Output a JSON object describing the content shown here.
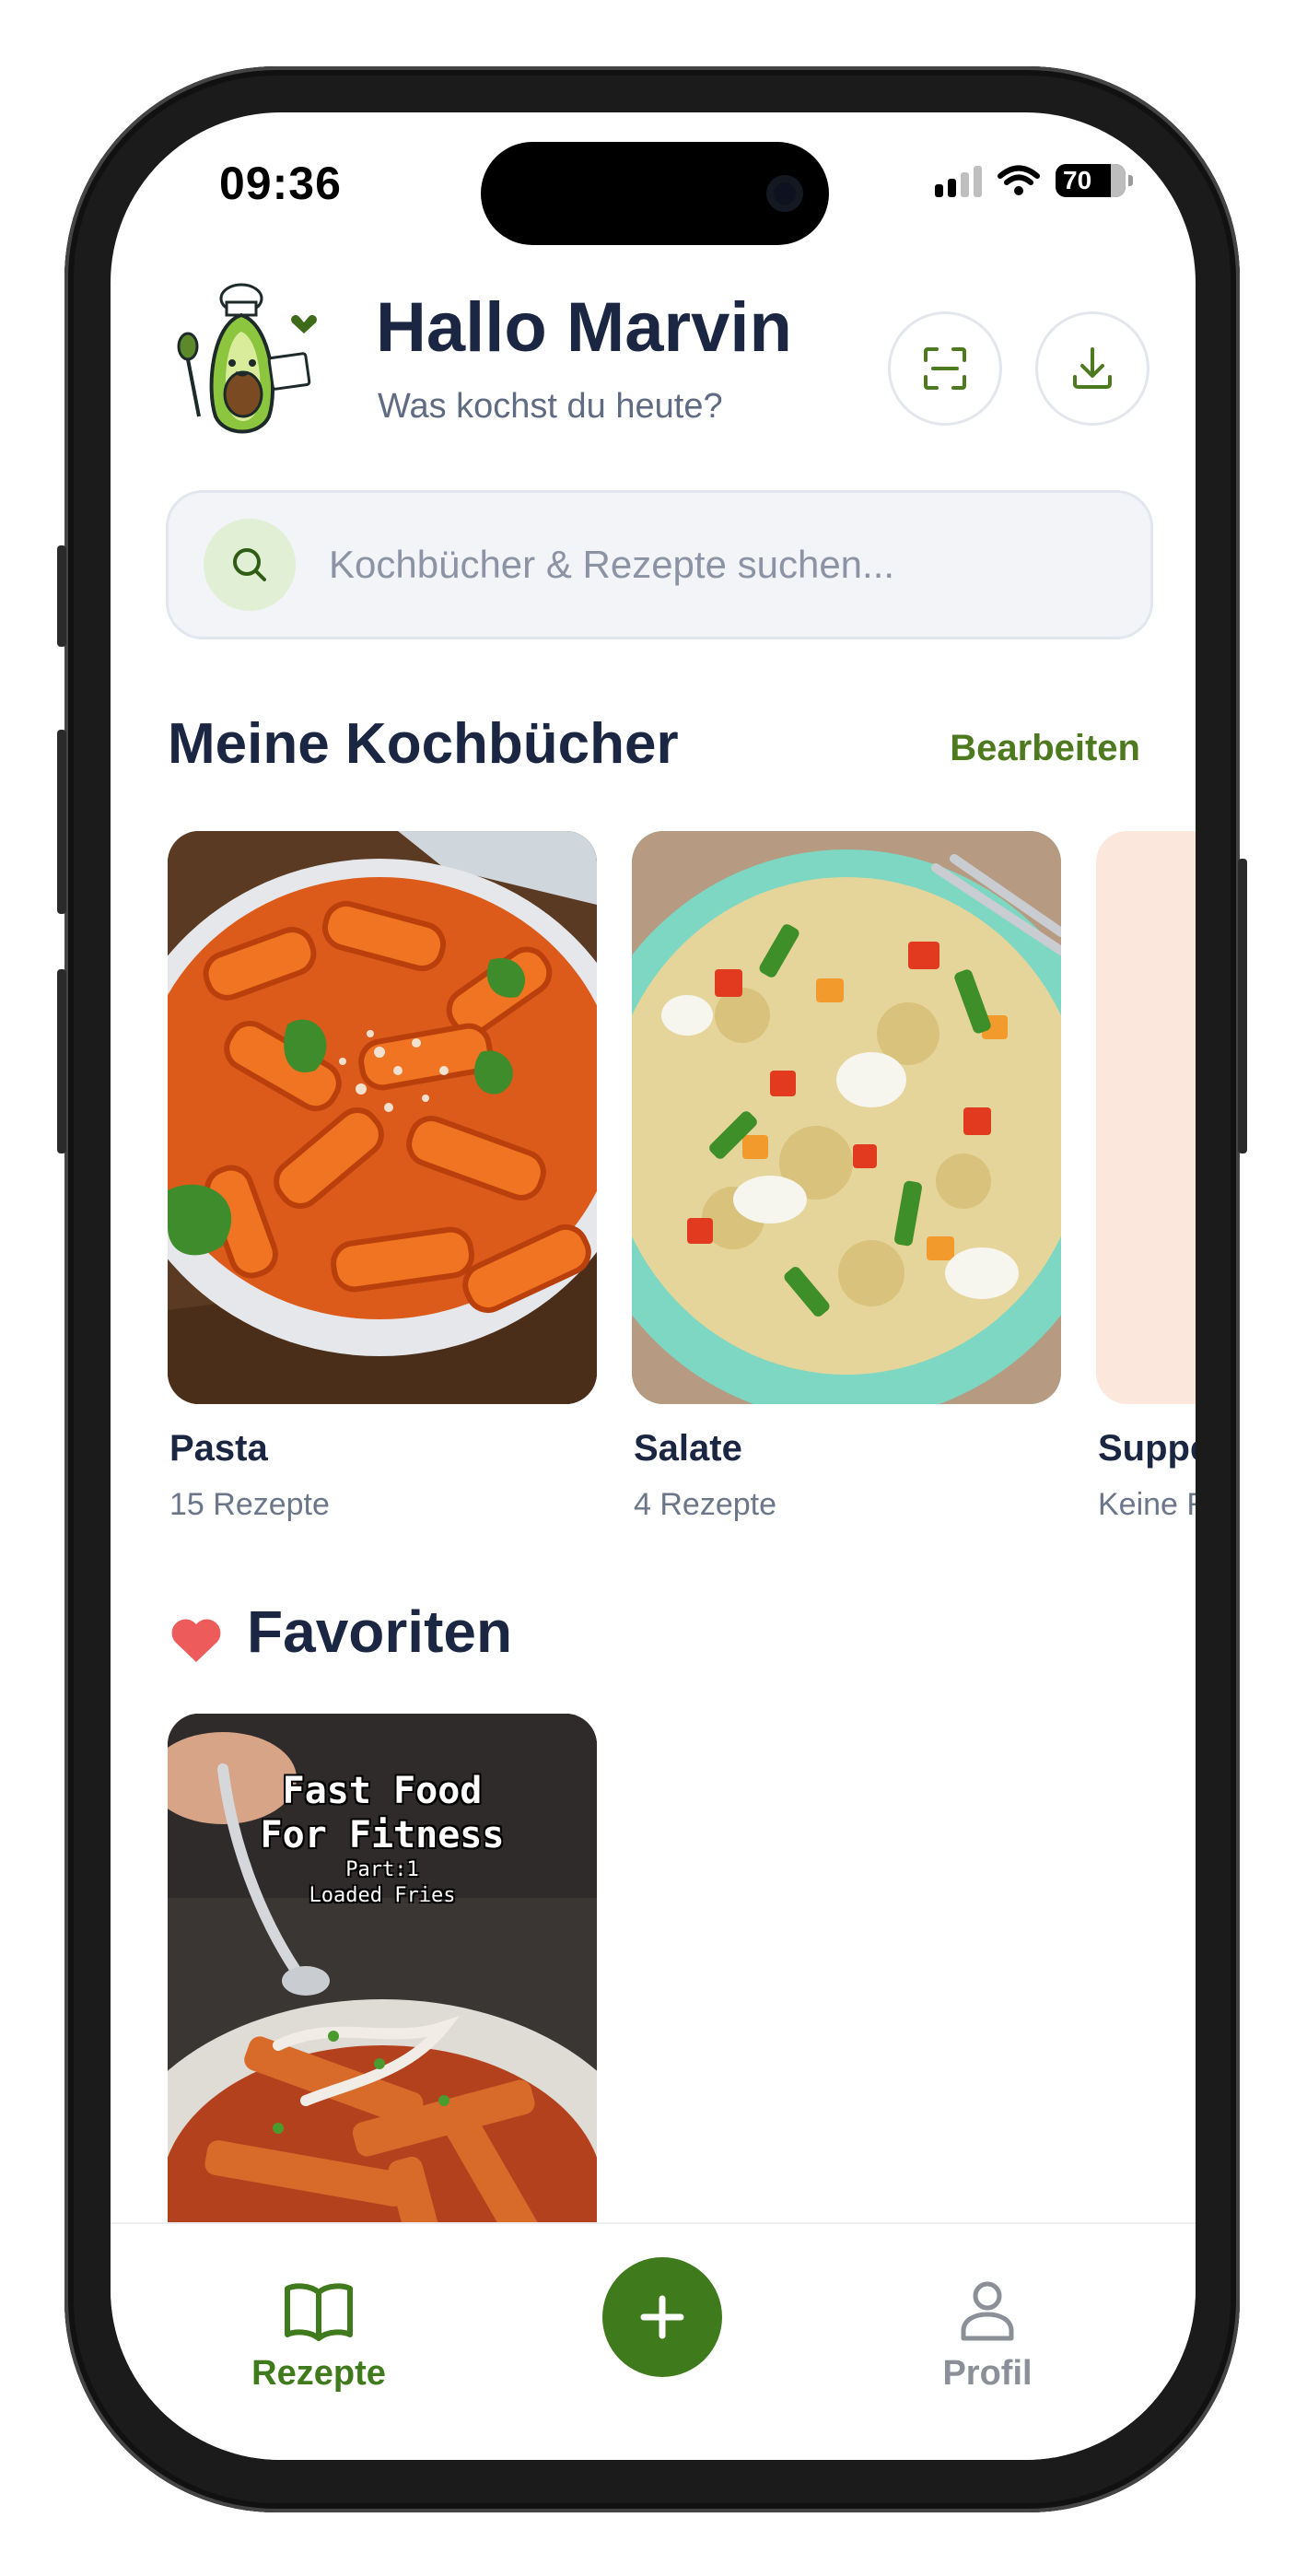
{
  "status": {
    "time": "09:36",
    "battery": "70"
  },
  "header": {
    "title": "Hallo Marvin",
    "subtitle": "Was kochst du heute?"
  },
  "search": {
    "placeholder": "Kochbücher & Rezepte suchen..."
  },
  "cookbooks": {
    "title": "Meine Kochbücher",
    "edit_label": "Bearbeiten",
    "items": [
      {
        "name": "Pasta",
        "count": "15 Rezepte"
      },
      {
        "name": "Salate",
        "count": "4 Rezepte"
      },
      {
        "name": "Suppe",
        "count": "Keine R"
      }
    ]
  },
  "favorites": {
    "title": "Favoriten",
    "items": [
      {
        "line1": "Fast Food",
        "line2": "For Fitness",
        "line3": "Part:1",
        "line4": "Loaded Fries"
      }
    ]
  },
  "tabbar": {
    "recipes_label": "Rezepte",
    "profile_label": "Profil"
  },
  "colors": {
    "accent": "#4e7a1f",
    "fab": "#3f7a1c",
    "heading": "#1b2643",
    "heart": "#ee5b5b"
  },
  "icons": [
    "search-icon",
    "scan-icon",
    "download-icon",
    "heart-icon",
    "book-icon",
    "plus-icon",
    "profile-icon"
  ]
}
